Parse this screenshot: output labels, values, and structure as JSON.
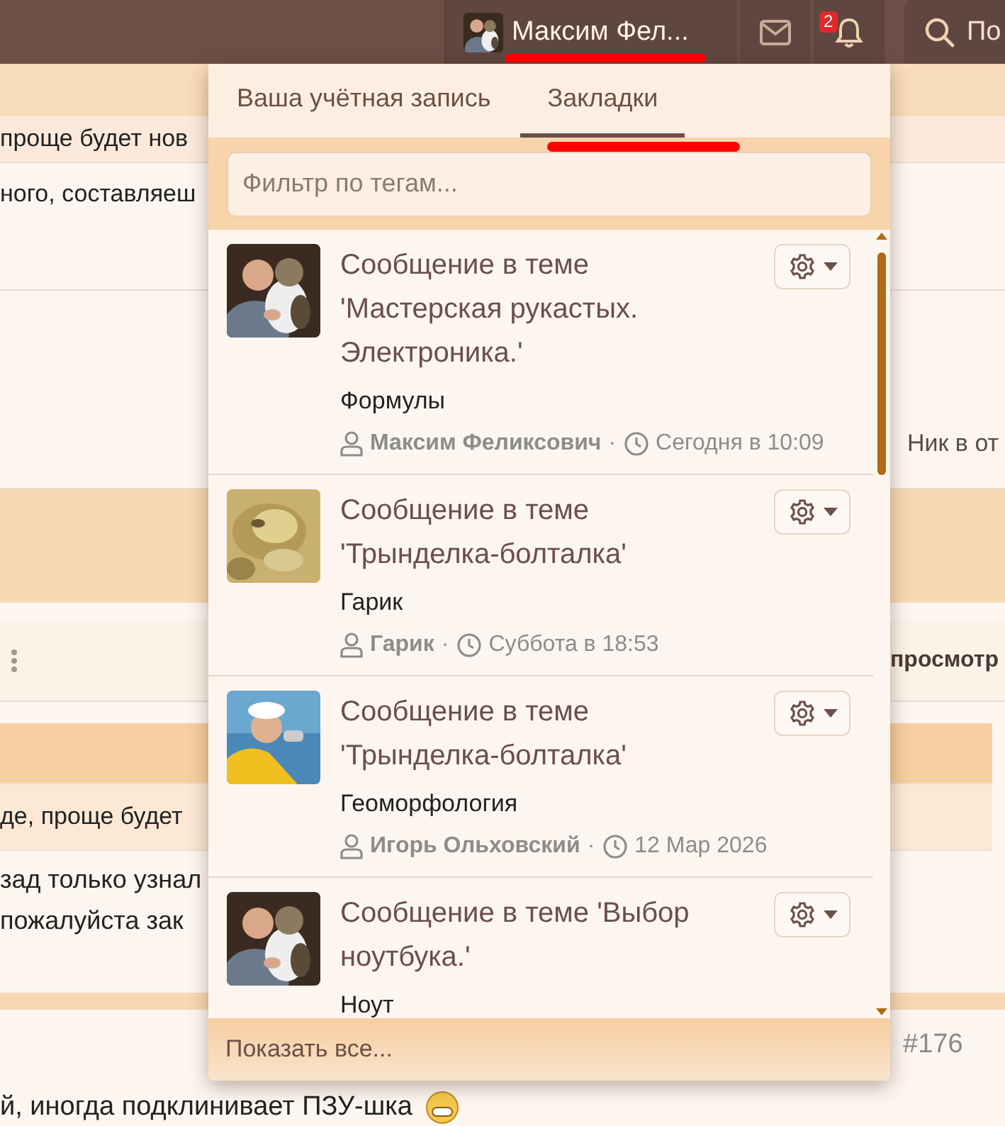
{
  "top_bar": {
    "user_name": "Максим Фел...",
    "notification_count": "2",
    "search_label": "По"
  },
  "page_behind": {
    "fragments": [
      "проще будет нов",
      "ного, составляеш",
      "Ник в от",
      "просмотр",
      "де, проще будет",
      "зад только узнал",
      "пожалуйста зак",
      "#176",
      "й, иногда подклинивает ПЗУ-шка"
    ]
  },
  "menu": {
    "tabs": [
      {
        "label": "Ваша учётная запись",
        "selected": false
      },
      {
        "label": "Закладки",
        "selected": true
      }
    ],
    "filter": {
      "placeholder": "Фильтр по тегам..."
    },
    "bookmarks": [
      {
        "title": "Сообщение в теме 'Мастерская рукастых. Электроника.'",
        "label": "Формулы",
        "author": "Максим Феликсович",
        "separator": "·",
        "date": "Сегодня в 10:09"
      },
      {
        "title": "Сообщение в теме 'Трынделка-болталка'",
        "label": "Гарик",
        "author": "Гарик",
        "separator": "·",
        "date": "Суббота в 18:53"
      },
      {
        "title": "Сообщение в теме 'Трынделка-болталка'",
        "label": "Геоморфология",
        "author": "Игорь Ольховский",
        "separator": "·",
        "date": "12 Мар 2026"
      },
      {
        "title": "Сообщение в теме 'Выбор ноутбука.'",
        "label": "Ноут"
      }
    ],
    "footer_link": "Показать все..."
  }
}
